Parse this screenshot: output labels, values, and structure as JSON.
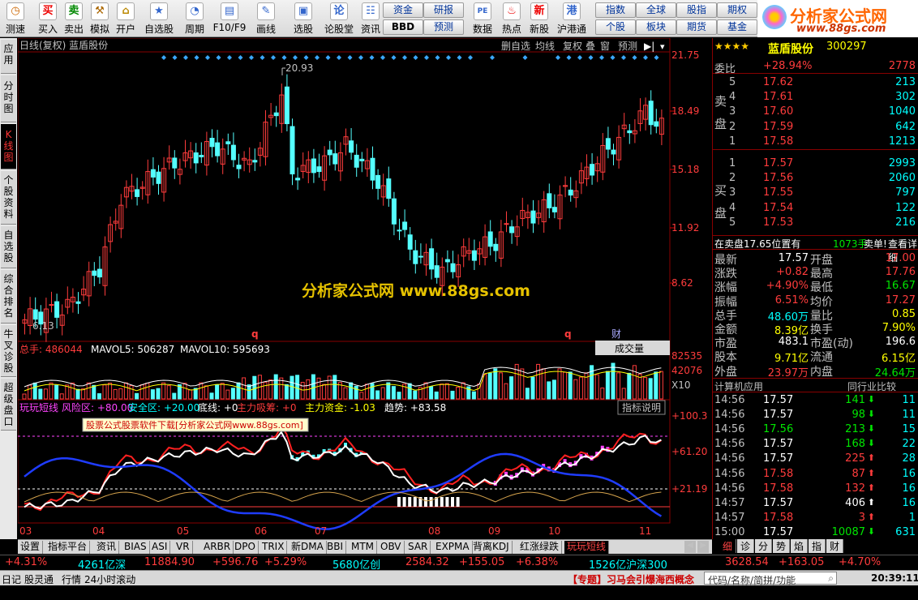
{
  "toolbar": {
    "items": [
      {
        "label": "测速",
        "ic": "◷"
      },
      {
        "label": "买入",
        "ic": "买"
      },
      {
        "label": "卖出",
        "ic": "卖"
      },
      {
        "label": "模拟",
        "ic": "⚒"
      },
      {
        "label": "开户",
        "ic": "🔒"
      },
      {
        "label": "自选股",
        "ic": "★"
      },
      {
        "label": "周期",
        "ic": "◔"
      },
      {
        "label": "F10/F9",
        "ic": "▤"
      },
      {
        "label": "画线",
        "ic": "✎"
      },
      {
        "label": "选股",
        "ic": "▣"
      },
      {
        "label": "论股堂",
        "ic": "论"
      },
      {
        "label": "资讯",
        "ic": "☷"
      },
      {
        "label": "数据",
        "ic": "PE"
      },
      {
        "label": "热点",
        "ic": "♨"
      },
      {
        "label": "新股",
        "ic": "新"
      },
      {
        "label": "沪港通",
        "ic": "港"
      }
    ],
    "squares": {
      "zijin": "资金",
      "bbd": "BBD",
      "yanbao": "研报",
      "yuce": "预测",
      "zhishu": "指数",
      "quanqiu": "全球",
      "guzhi": "股指",
      "qiquan": "期权",
      "gegu": "个股",
      "bankuai": "板块",
      "qihuo": "期货",
      "jijin": "基金"
    }
  },
  "logo": {
    "title": "分析家公式网",
    "url": "www.88gs.com"
  },
  "left_tabs": [
    "应用",
    "分时图",
    "K线图",
    "个股资料",
    "自选股",
    "综合排名",
    "牛叉诊股",
    "超级盘口"
  ],
  "chart": {
    "title": "日线(复权) 蓝盾股份",
    "top_buttons": [
      "删自选",
      "均线",
      "复权",
      "叠",
      "窗",
      "预测"
    ],
    "price_labels": [
      "21.75",
      "18.49",
      "15.18",
      "11.92",
      "8.62"
    ],
    "hi_label": "20.93",
    "lo_label": "6.13",
    "watermark": "分析家公式网  www.88gs.com",
    "marks": [
      "q",
      "q",
      "财"
    ],
    "vol_header": {
      "total": "总手: 486044",
      "mavol5": "MAVOL5: 506287",
      "mavol10": "MAVOL10: 595693",
      "selector": "成交量"
    },
    "vol_labels": [
      "82535",
      "42076",
      "X10"
    ],
    "ind_header": {
      "name": "玩玩短线",
      "risk": "风险区: +80.00",
      "safe": "安全区: +20.00",
      "bottom": "底线: +0",
      "main_suck": "主力吸筹: +0",
      "main_fund": "主力资金: -1.03",
      "trend": "趋势: +83.58",
      "btn": "指标说明"
    },
    "ind_labels": [
      "+100.3",
      "+61.20",
      "+21.19"
    ],
    "ad_text": "股票公式股票软件下载[分析家公式网www.88gs.com]",
    "months": [
      "03",
      "04",
      "05",
      "06",
      "07",
      "08",
      "09",
      "10",
      "11"
    ]
  },
  "bottom_tabs": [
    "设置",
    "指标平台",
    "资讯",
    "BIAS",
    "ASI",
    "VR",
    "ARBR",
    "DPO",
    "TRIX",
    "新DMA",
    "BBI",
    "MTM",
    "OBV",
    "SAR",
    "EXPMA",
    "背离KDJ",
    "红涨绿跌",
    "玩玩短线"
  ],
  "right_panel": {
    "stock_name": "蓝盾股份",
    "code": "300297",
    "weibi_label": "委比",
    "weibi": "+28.94%",
    "weicha": "2778",
    "sell": [
      {
        "n": "5",
        "p": "17.62",
        "v": "213"
      },
      {
        "n": "4",
        "p": "17.61",
        "v": "302"
      },
      {
        "n": "3",
        "p": "17.60",
        "v": "1040"
      },
      {
        "n": "2",
        "p": "17.59",
        "v": "642"
      },
      {
        "n": "1",
        "p": "17.58",
        "v": "1213"
      }
    ],
    "buy": [
      {
        "n": "1",
        "p": "17.57",
        "v": "2993"
      },
      {
        "n": "2",
        "p": "17.56",
        "v": "2060"
      },
      {
        "n": "3",
        "p": "17.55",
        "v": "797"
      },
      {
        "n": "4",
        "p": "17.54",
        "v": "122"
      },
      {
        "n": "5",
        "p": "17.53",
        "v": "216"
      }
    ],
    "sell_label": "卖盘",
    "buy_label": "买盘",
    "info_line": "在卖盘17.65位置有",
    "info_vol": "1073手",
    "info_tag": "卖单!",
    "info_link": "查看详细",
    "quote": [
      {
        "a": "最新",
        "av": "17.57",
        "b": "开盘",
        "bv": "17.00"
      },
      {
        "a": "涨跌",
        "av": "+0.82",
        "b": "最高",
        "bv": "17.76"
      },
      {
        "a": "涨幅",
        "av": "+4.90%",
        "b": "最低",
        "bv": "16.67"
      },
      {
        "a": "振幅",
        "av": "6.51%",
        "b": "均价",
        "bv": "17.27"
      },
      {
        "a": "总手",
        "av": "48.60万",
        "b": "量比",
        "bv": "0.85"
      },
      {
        "a": "金额",
        "av": "8.39亿",
        "b": "换手",
        "bv": "7.90%"
      },
      {
        "a": "市盈",
        "av": "483.1",
        "b": "市盈(动)",
        "bv": "196.6"
      },
      {
        "a": "股本",
        "av": "9.71亿",
        "b": "流通",
        "bv": "6.15亿"
      },
      {
        "a": "外盘",
        "av": "23.97万",
        "b": "内盘",
        "bv": "24.64万"
      }
    ],
    "industry": "计算机应用",
    "compare": "同行业比较",
    "ticks": [
      {
        "t": "14:56",
        "p": "17.57",
        "v": "141",
        "d": "down",
        "n": "11"
      },
      {
        "t": "14:56",
        "p": "17.57",
        "v": "98",
        "d": "down",
        "n": "11"
      },
      {
        "t": "14:56",
        "p": "17.56",
        "v": "213",
        "d": "down",
        "n": "15"
      },
      {
        "t": "14:56",
        "p": "17.57",
        "v": "168",
        "d": "down",
        "n": "22"
      },
      {
        "t": "14:56",
        "p": "17.57",
        "v": "225",
        "d": "up",
        "n": "28"
      },
      {
        "t": "14:56",
        "p": "17.58",
        "v": "87",
        "d": "up",
        "n": "16"
      },
      {
        "t": "14:56",
        "p": "17.58",
        "v": "132",
        "d": "up",
        "n": "16"
      },
      {
        "t": "14:57",
        "p": "17.57",
        "v": "406",
        "d": "flat",
        "n": "16"
      },
      {
        "t": "14:57",
        "p": "17.58",
        "v": "3",
        "d": "up",
        "n": "1"
      },
      {
        "t": "15:00",
        "p": "17.57",
        "v": "10087",
        "d": "down",
        "n": "631"
      }
    ],
    "tabs": [
      "细",
      "诊",
      "分",
      "势",
      "焰",
      "指",
      "财"
    ]
  },
  "status": {
    "s1": "+4.31%",
    "s2": "4261亿深",
    "s3": "11884.90",
    "s4": "+596.76",
    "s5": "+5.29%",
    "s6": "5680亿创",
    "s7": "2584.32",
    "s8": "+155.05",
    "s9": "+6.38%",
    "s10": "1526亿沪深300",
    "s11": "3628.54",
    "s12": "+163.05",
    "s13": "+4.70%"
  },
  "status2": {
    "a": "日记",
    "b": "股灵通",
    "c": "行情",
    "d": "24小时滚动",
    "news": "【专题】习马会引爆海西概念",
    "search": "代码/名称/简拼/功能",
    "time": "20:39:11"
  }
}
